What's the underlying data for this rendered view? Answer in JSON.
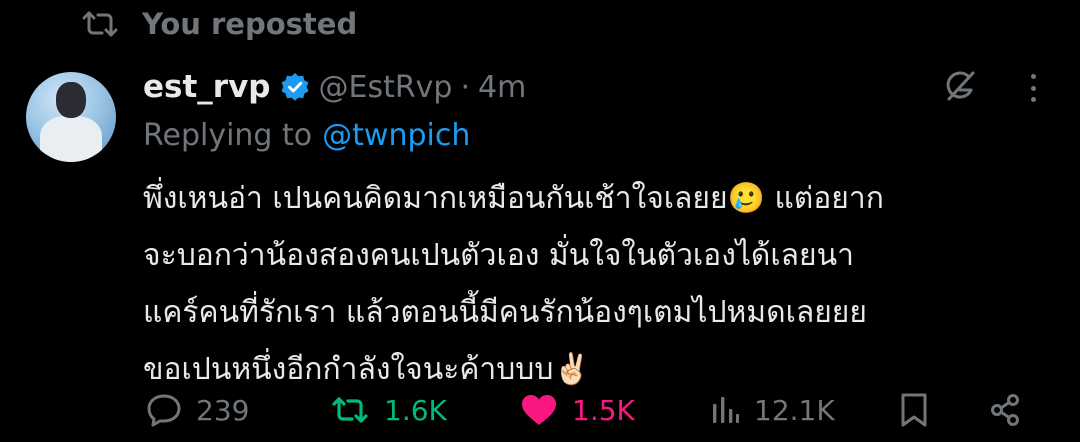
{
  "repost_banner": {
    "icon": "repost-icon",
    "text": "You reposted"
  },
  "tweet": {
    "display_name": "est_rvp",
    "handle": "@EstRvp",
    "separator": "·",
    "time": "4m",
    "replying_prefix": "Replying to",
    "replying_to": "@twnpich",
    "text_lines": [
      "พึ่งเหนอ่า เปนคนคิดมากเหมือนกันเช้าใจเลยย🥲 แต่อยาก",
      "จะบอกว่าน้องสองคนเปนตัวเอง มั่นใจในตัวเองได้เลยนา",
      "แคร์คนที่รักเรา แล้วตอนนี้มีคนรักน้องๆเตมไปหมดเลยยย",
      "ขอเปนหนึ่งอีกกำลังใจนะค้าบบบ✌🏻"
    ]
  },
  "actions": {
    "replies": "239",
    "reposts": "1.6K",
    "likes": "1.5K",
    "views": "12.1K"
  },
  "colors": {
    "background": "#000000",
    "text": "#e7e9ea",
    "muted": "#71767b",
    "link": "#1d9bf0",
    "verified": "#1d9bf0",
    "repost": "#00ba7c",
    "like": "#f91880"
  }
}
